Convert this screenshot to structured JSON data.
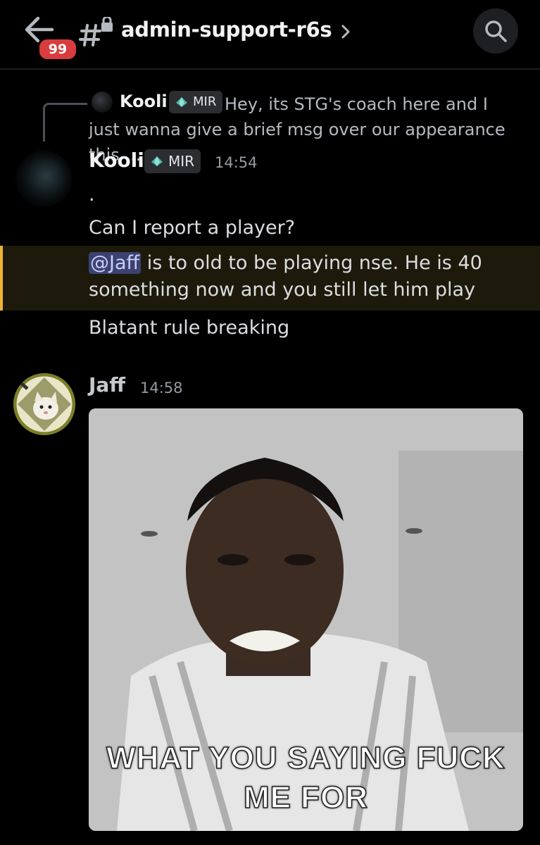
{
  "header": {
    "unread_badge": "99",
    "channel_name": "admin-support-r6s"
  },
  "reply_preview": {
    "author": "Kooli",
    "role_tag": "MIR",
    "text": "Hey, its STG's coach here and I just wanna give a brief msg over our appearance this ..."
  },
  "messages": [
    {
      "author": "Kooli",
      "role_tag": "MIR",
      "time": "14:54",
      "lines": [
        ".",
        "Can I report a player?"
      ],
      "mention": "@Jaff",
      "mention_text": " is to old to be playing nse. He is 40 something now and you still let him play",
      "last_line": "Blatant rule breaking"
    },
    {
      "author": "Jaff",
      "time": "14:58",
      "gif_caption_line1": "WHAT YOU SAYING FUCK",
      "gif_caption_line2": "ME FOR"
    }
  ],
  "colors": {
    "background": "#000000",
    "badge": "#d83c3e",
    "mention_bg": "#3c4270",
    "highlight_bar": "#f0b232"
  },
  "icons": [
    "back-arrow-icon",
    "locked-channel-hash-icon",
    "chevron-right-icon",
    "search-icon",
    "role-gem-icon"
  ]
}
